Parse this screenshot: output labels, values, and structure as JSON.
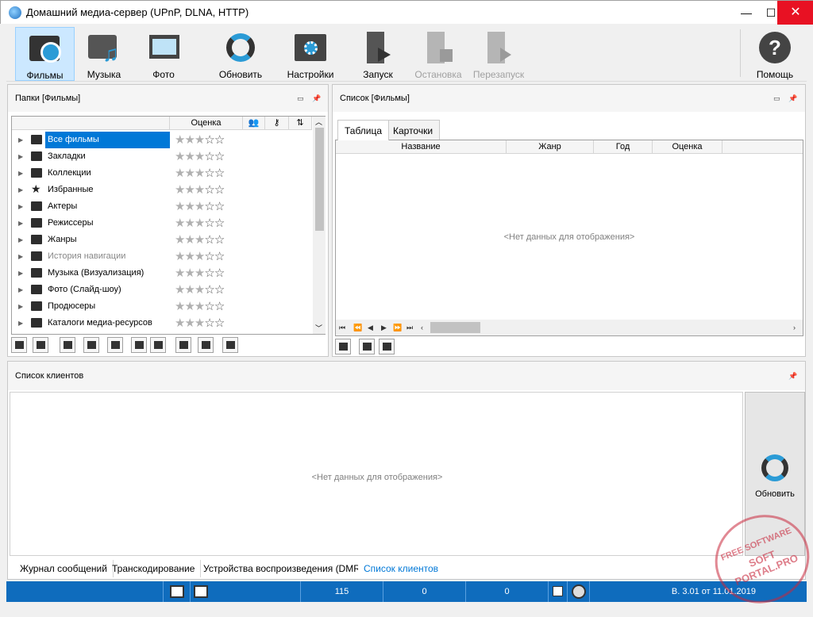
{
  "window": {
    "title": "Домашний медиа-сервер (UPnP, DLNA, HTTP)",
    "controls": {
      "minimize": "—",
      "maximize": "☐",
      "close": "✕"
    }
  },
  "toolbar": {
    "films": "Фильмы",
    "music": "Музыка",
    "photo": "Фото",
    "refresh": "Обновить",
    "settings": "Настройки",
    "start": "Запуск",
    "stop": "Остановка",
    "restart": "Перезапуск",
    "help": "Помощь"
  },
  "folders_panel": {
    "title": "Папки [Фильмы]",
    "column_rating": "Оценка",
    "items": [
      {
        "label": "Все фильмы",
        "icon": "folder-open-icon",
        "selected": true,
        "rating": 3
      },
      {
        "label": "Закладки",
        "icon": "bookmark-folder-icon",
        "rating": 3
      },
      {
        "label": "Коллекции",
        "icon": "collections-icon",
        "rating": 3
      },
      {
        "label": "Избранные",
        "icon": "star-icon",
        "rating": 3
      },
      {
        "label": "Актеры",
        "icon": "actors-icon",
        "rating": 3
      },
      {
        "label": "Режиссеры",
        "icon": "directors-icon",
        "rating": 3
      },
      {
        "label": "Жанры",
        "icon": "genres-icon",
        "rating": 3
      },
      {
        "label": "История навигации",
        "icon": "history-icon",
        "dim": true,
        "rating": 3
      },
      {
        "label": "Музыка (Визуализация)",
        "icon": "music-viz-icon",
        "rating": 3
      },
      {
        "label": "Фото (Слайд-шоу)",
        "icon": "slideshow-icon",
        "rating": 3
      },
      {
        "label": "Продюсеры",
        "icon": "producers-icon",
        "rating": 3
      },
      {
        "label": "Каталоги медиа-ресурсов",
        "icon": "catalogs-icon",
        "rating": 3
      }
    ]
  },
  "list_panel": {
    "title": "Список [Фильмы]",
    "tabs": [
      "Таблица",
      "Карточки"
    ],
    "columns": [
      "Название",
      "Жанр",
      "Год",
      "Оценка"
    ],
    "empty": "<Нет данных для отображения>"
  },
  "clients_panel": {
    "title": "Список клиентов",
    "empty": "<Нет данных для отображения>",
    "refresh": "Обновить"
  },
  "bottom_tabs": [
    "Журнал сообщений",
    "Транскодирование",
    "Устройства воспроизведения (DMR)",
    "Список клиентов"
  ],
  "statusbar": {
    "count1": "115",
    "count2": "0",
    "count3": "0",
    "version": "В. 3.01 от 11.01.2019"
  },
  "watermark": "FREE SOFTWARE SOFT PORTAL.PRO",
  "colors": {
    "accent": "#0078d7",
    "statusbar": "#0f6cbd",
    "close": "#e81123"
  }
}
